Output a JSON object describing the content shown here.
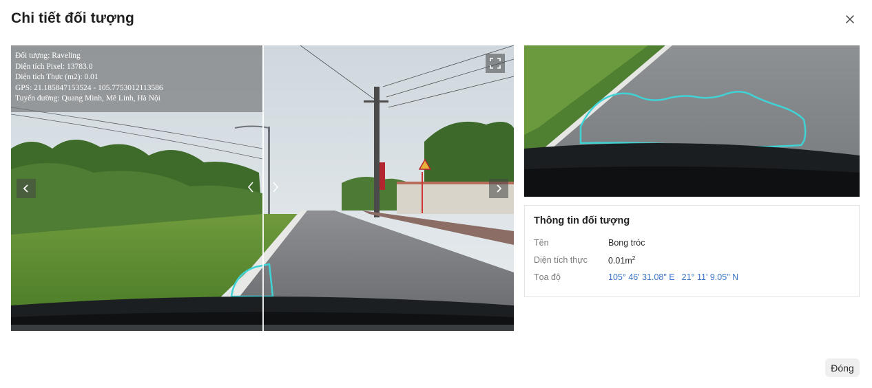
{
  "modal": {
    "title": "Chi tiết đối tượng",
    "close_icon": "close-icon",
    "footer_button": "Đóng"
  },
  "viewer": {
    "overlay_lines": [
      "Đối tượng: Raveling",
      "Diện tích Pixel: 13783.0",
      "Diện tích Thực (m2): 0.01",
      "GPS: 21.185847153524 - 105.7753012113586",
      "Tuyến đường: Quang Minh, Mê Linh, Hà Nội"
    ],
    "icons": {
      "prev": "chevron-left-icon",
      "next": "chevron-right-icon",
      "fullscreen": "fullscreen-icon"
    },
    "colors": {
      "detection_outline": "#3fd3d6"
    }
  },
  "info": {
    "title": "Thông tin đối tượng",
    "rows": [
      {
        "label": "Tên",
        "value": "Bong tróc"
      },
      {
        "label": "Diện tích thực",
        "value": "0.01m",
        "unit_sup": "2"
      },
      {
        "label": "Tọa độ",
        "coords": [
          "105° 46' 31.08\" E",
          "21° 11' 9.05\" N"
        ]
      }
    ],
    "colors": {
      "coordinate_link": "#3a74c7"
    }
  }
}
